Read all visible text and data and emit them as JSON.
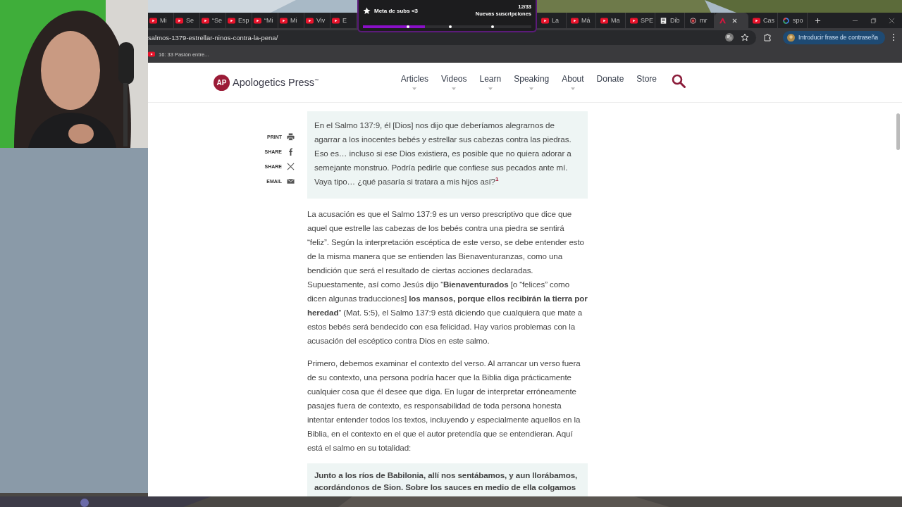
{
  "overlay_widget": {
    "title": "Meta de subs <3",
    "count": "12/33",
    "caption": "Nuevas suscripciones",
    "level": 0.37
  },
  "tabs_left": [
    {
      "label": "Mi",
      "kind": "youtube",
      "selected": false
    },
    {
      "label": "Se",
      "kind": "youtube",
      "selected": false
    },
    {
      "label": "“Se",
      "kind": "youtube",
      "selected": false
    },
    {
      "label": "Esp",
      "kind": "youtube",
      "selected": false
    },
    {
      "label": "“Mi",
      "kind": "youtube",
      "selected": false
    },
    {
      "label": "Mi",
      "kind": "youtube",
      "selected": false
    },
    {
      "label": "Viv",
      "kind": "youtube",
      "selected": false
    },
    {
      "label": "E",
      "kind": "youtube",
      "selected": false
    }
  ],
  "tabs_right": [
    {
      "label": "La",
      "kind": "youtube",
      "selected": false
    },
    {
      "label": "Má",
      "kind": "youtube",
      "selected": false
    },
    {
      "label": "Ma",
      "kind": "youtube",
      "selected": false
    },
    {
      "label": "SPE",
      "kind": "youtube",
      "selected": false
    },
    {
      "label": "Dib",
      "kind": "document",
      "selected": false
    },
    {
      "label": "mr",
      "kind": "shield",
      "selected": false
    },
    {
      "kind": "site",
      "selected": true
    },
    {
      "label": "Cas",
      "kind": "youtube",
      "selected": false
    },
    {
      "label": "spo",
      "kind": "google",
      "selected": false
    }
  ],
  "address_bar": {
    "url": "salmos-1379-estrellar-ninos-contra-la-pena/"
  },
  "profile_button": {
    "label": "Introducir frase de contraseña"
  },
  "bookmarks": [
    {
      "label": "16: 33 Pasión entre..."
    }
  ],
  "site": {
    "logo_mark": "AP",
    "name": "Apologetics Press$^{™}$",
    "nav": [
      {
        "label": "Articles",
        "dropdown": true
      },
      {
        "label": "Videos",
        "dropdown": true
      },
      {
        "label": "Learn",
        "dropdown": true
      },
      {
        "label": "Speaking",
        "dropdown": true
      },
      {
        "label": "About",
        "dropdown": true
      },
      {
        "label": "Donate",
        "dropdown": false
      },
      {
        "label": "Store",
        "dropdown": false
      }
    ]
  },
  "share_links": [
    {
      "label": "PRINT",
      "kind": "print"
    },
    {
      "label": "SHARE",
      "kind": "facebook"
    },
    {
      "label": "SHARE",
      "kind": "x"
    },
    {
      "label": "EMAIL",
      "kind": "email"
    }
  ],
  "article": [
    {
      "kind": "quote",
      "text": "En el Salmo 137:9, él [Dios] nos dijo que deberíamos alegrarnos de agarrar a los inocentes bebés y estrellar sus cabezas contra las piedras. Eso es… incluso si ese Dios existiera, es posible que no quiera adorar a semejante monstruo. Podría pedirle que confiese sus pecados ante mí. Vaya tipo… ¿qué pasaría si tratara a mis hijos así?$^{1}$"
    },
    {
      "kind": "paragraph",
      "text": "La acusación es que el Salmo 137:9 es un verso prescriptivo que dice que aquel que estrelle las cabezas de los bebés contra una piedra se sentirá “feliz”. Según la interpretación escéptica de este verso, se debe entender esto de la misma manera que se entienden las Bienaventuranzas, como una bendición que será el resultado de ciertas acciones declaradas. Supuestamente, así como Jesús dijo “**Bienaventurados** [o “felices” como dicen algunas traducciones] **los mansos, porque ellos recibirán la tierra por heredad**” (Mat. 5:5), el Salmo 137:9 está diciendo que cualquiera que mate a estos bebés será bendecido con esa felicidad. Hay varios problemas con la acusación del escéptico contra Dios en este salmo."
    },
    {
      "kind": "paragraph",
      "text": "Primero, debemos examinar el contexto del verso. Al arrancar un verso fuera de su contexto, una persona podría hacer que la Biblia diga prácticamente cualquier cosa que él desee que diga. En lugar de interpretar erróneamente pasajes fuera de contexto, es responsabilidad de toda persona honesta intentar entender todos los textos, incluyendo y especialmente aquellos en la Biblia, en el contexto en el que el autor pretendía que se entendieran. Aquí está el salmo en su totalidad:"
    },
    {
      "kind": "scripture",
      "text": "Junto a los ríos de Babilonia, allí nos sentábamos, y aun llorábamos, acordándonos de Sion. Sobre los sauces en medio de ella colgamos"
    }
  ]
}
